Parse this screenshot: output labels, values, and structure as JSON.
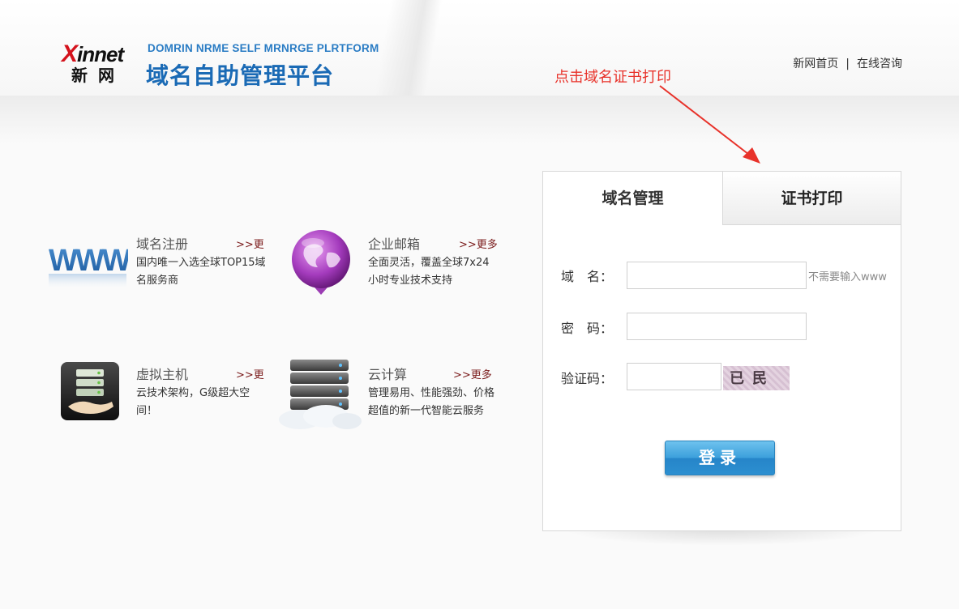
{
  "header": {
    "brand_en": "innet",
    "brand_x": "X",
    "brand_cn": "新 网",
    "site_title_en": "DOMRIN NRME SELF MRNRGE PLRTFORM",
    "site_title_cn": "域名自助管理平台",
    "nav": [
      {
        "label": "新网首页"
      },
      {
        "label": "在线咨询"
      }
    ],
    "nav_separator": "|"
  },
  "annotation": {
    "text": "点击域名证书打印",
    "color": "#e8322a"
  },
  "services": [
    {
      "icon": "www-icon",
      "title": "域名注册",
      "more": ">>更",
      "desc": "国内唯一入选全球TOP15域名服务商"
    },
    {
      "icon": "email-globe-icon",
      "title": "企业邮箱",
      "more": ">>更多",
      "desc": "全面灵活，覆盖全球7x24小时专业技术支持"
    },
    {
      "icon": "server-hand-icon",
      "title": "虚拟主机",
      "more": ">>更",
      "desc": "云技术架构，G级超大空间！"
    },
    {
      "icon": "cloud-server-icon",
      "title": "云计算",
      "more": ">>更多",
      "desc": "管理易用、性能强劲、价格超值的新一代智能云服务"
    }
  ],
  "login": {
    "tabs": [
      {
        "label": "域名管理"
      },
      {
        "label": "证书打印"
      }
    ],
    "domain_label": "域　名：",
    "domain_value": "",
    "domain_hint": "不需要输入www",
    "password_label": "密　码：",
    "password_value": "",
    "captcha_label": "验证码：",
    "captcha_value": "",
    "captcha_text": "已民",
    "submit_label": "登录"
  },
  "colors": {
    "brand_blue": "#1a6ab5",
    "brand_red": "#d4121c",
    "button_blue": "#3b9fdb"
  }
}
